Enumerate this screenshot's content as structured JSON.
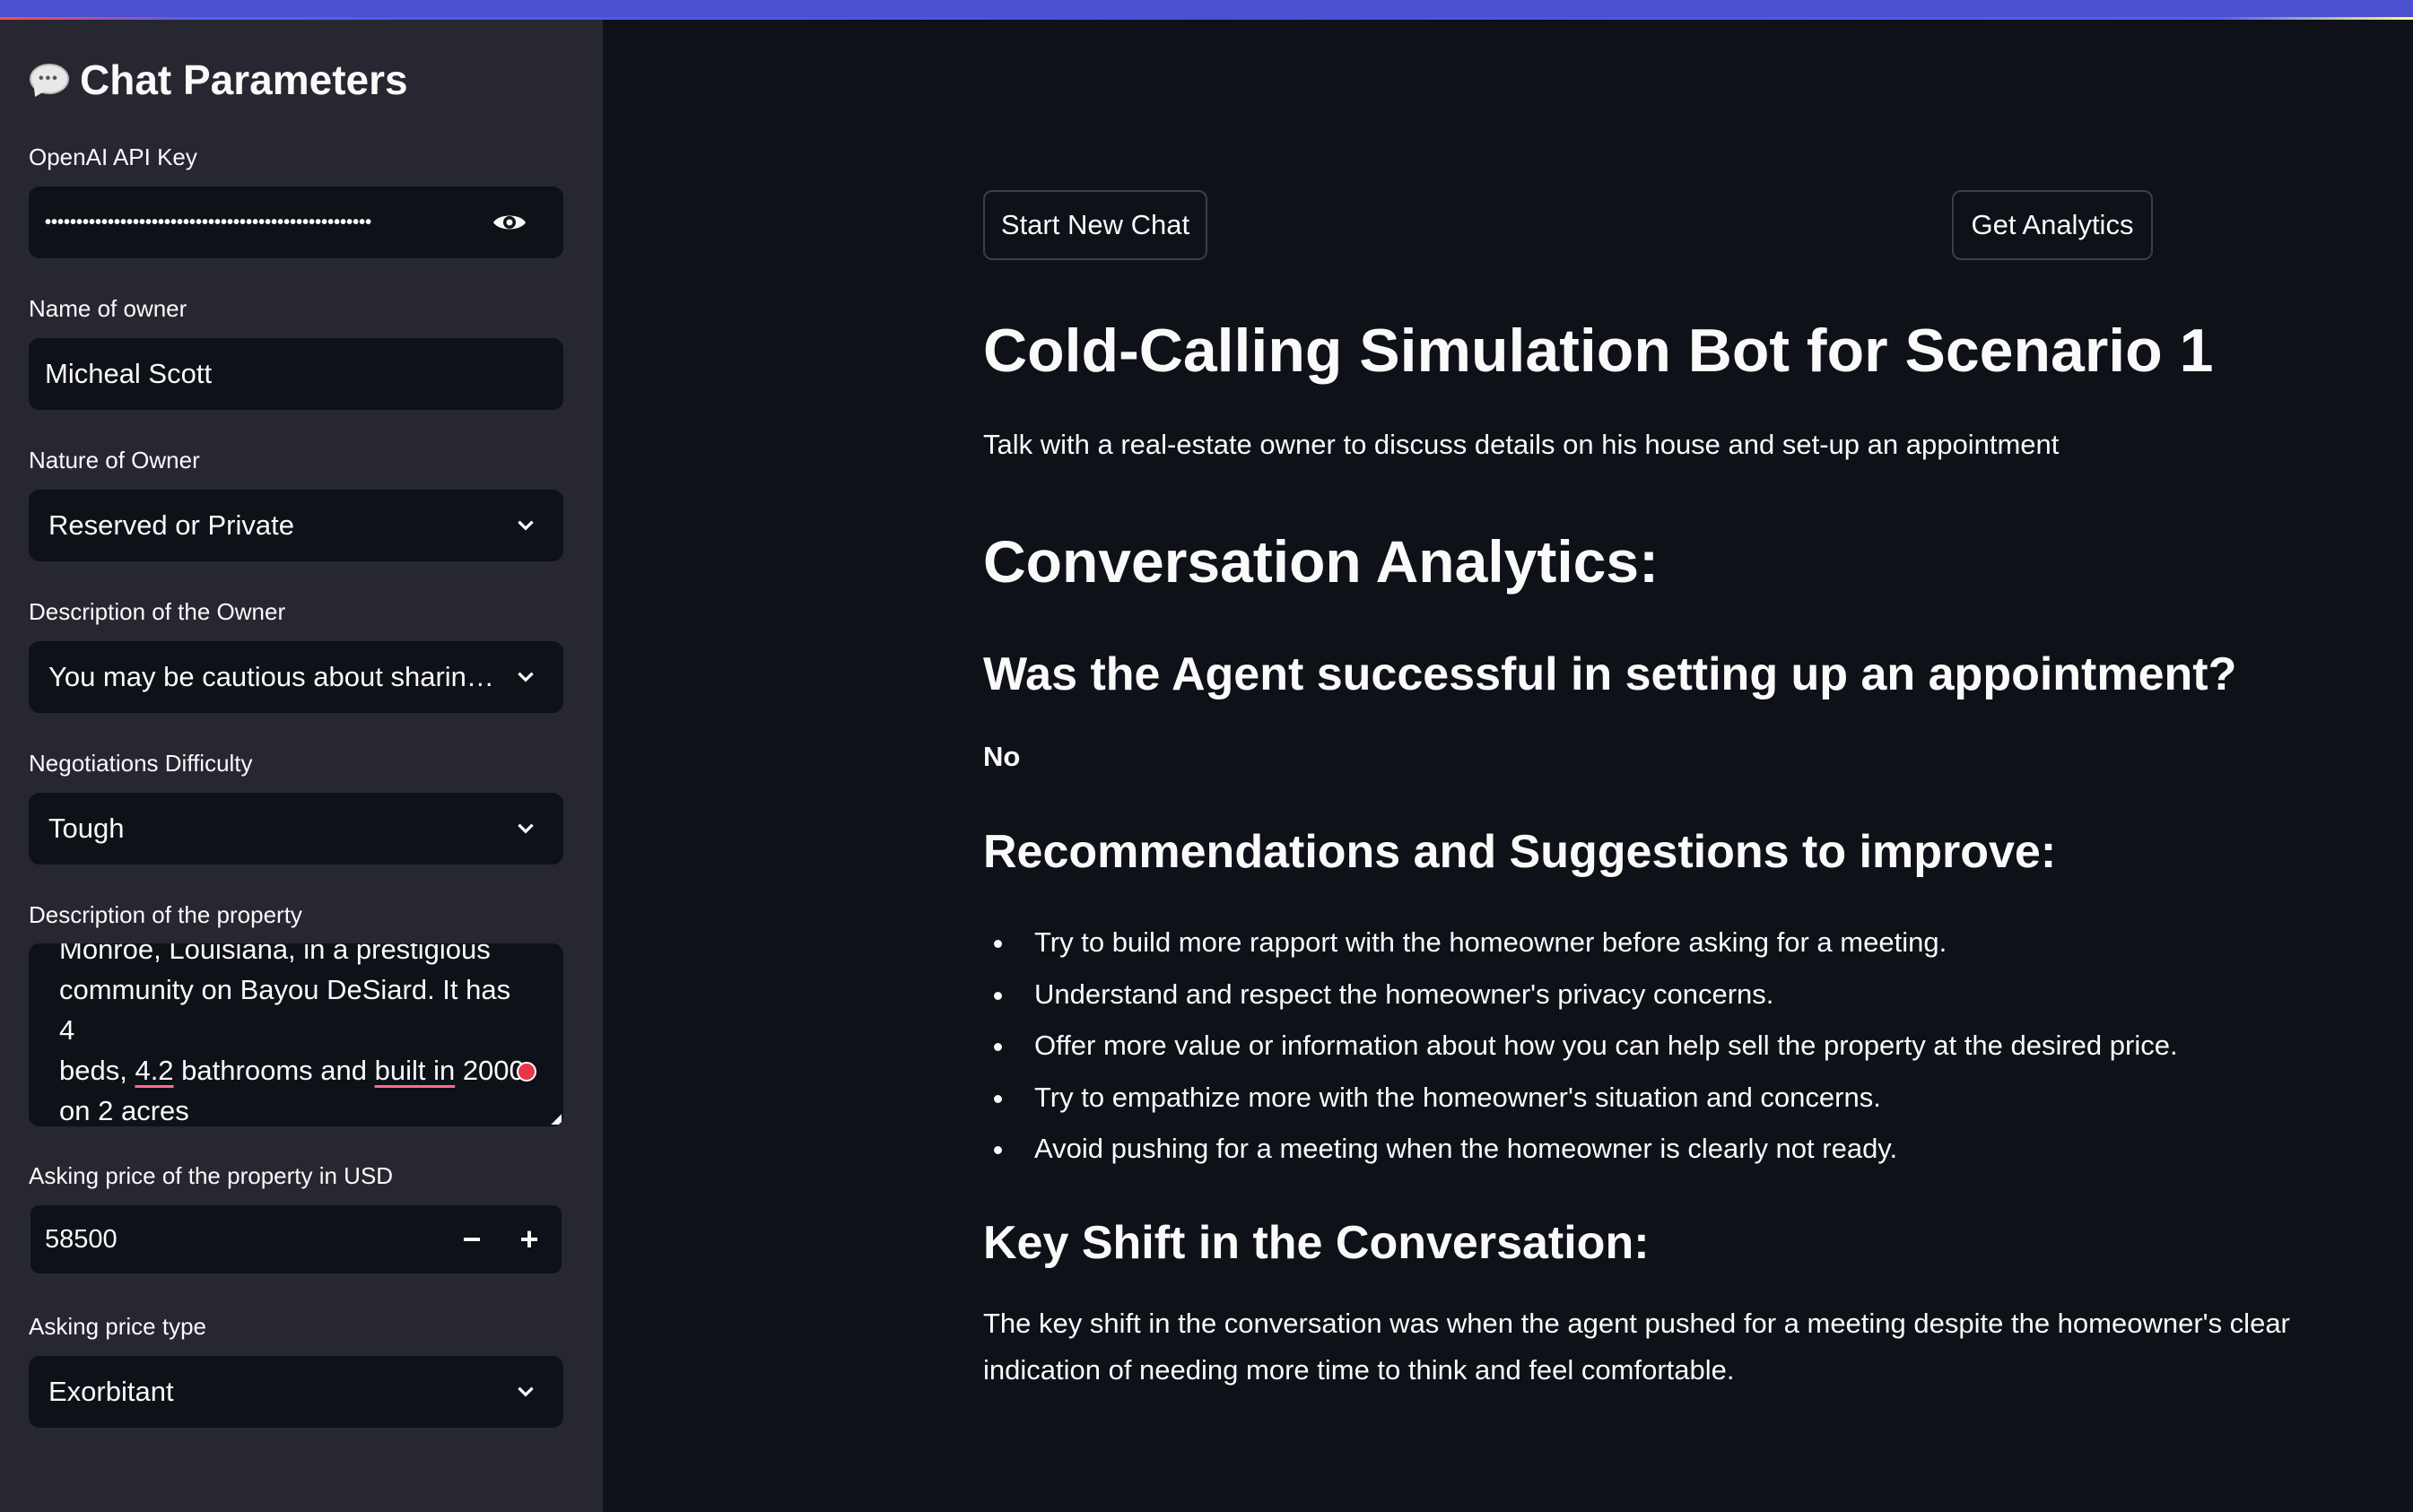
{
  "sidebar": {
    "title": "Chat Parameters",
    "api_key_label": "OpenAI API Key",
    "api_key_value": "••••••••••••••••••••••••••••••••••••••••••••••••••••",
    "owner_name_label": "Name of owner",
    "owner_name_value": "Micheal Scott",
    "nature_label": "Nature of Owner",
    "nature_value": "Reserved or Private",
    "description_label": "Description of the Owner",
    "description_value": "You may be cautious about sharin…",
    "difficulty_label": "Negotiations Difficulty",
    "difficulty_value": "Tough",
    "property_label": "Description of the property",
    "property_text": {
      "line1": "Monroe, Louisiana, in a prestigious",
      "line2": "community on Bayou DeSiard. It has 4",
      "line3_a": "beds, ",
      "line3_b": "4.2",
      "line3_c": " bathrooms and ",
      "line3_d": "built in",
      "line3_e": " 2000",
      "line4": "on 2 acres"
    },
    "price_label": "Asking price of the property in USD",
    "price_value": "58500",
    "price_minus": "−",
    "price_plus": "+",
    "price_type_label": "Asking price type",
    "price_type_value": "Exorbitant"
  },
  "main": {
    "start_button": "Start New Chat",
    "analytics_button": "Get Analytics",
    "title": "Cold-Calling Simulation Bot for Scenario 1",
    "subtitle": "Talk with a real-estate owner to discuss details on his house and set-up an appointment",
    "analytics_heading": "Conversation Analytics:",
    "success_question": "Was the Agent successful in setting up an appointment?",
    "success_answer": "No",
    "recommendations_heading": "Recommendations and Suggestions to improve:",
    "recommendations": [
      "Try to build more rapport with the homeowner before asking for a meeting.",
      "Understand and respect the homeowner's privacy concerns.",
      "Offer more value or information about how you can help sell the property at the desired price.",
      "Try to empathize more with the homeowner's situation and concerns.",
      "Avoid pushing for a meeting when the homeowner is clearly not ready."
    ],
    "key_shift_heading": "Key Shift in the Conversation:",
    "key_shift_line1": "The key shift in the conversation was when the agent pushed for a meeting despite the homeowner's clear",
    "key_shift_line2": "indication of needing more time to think and feel comfortable."
  }
}
